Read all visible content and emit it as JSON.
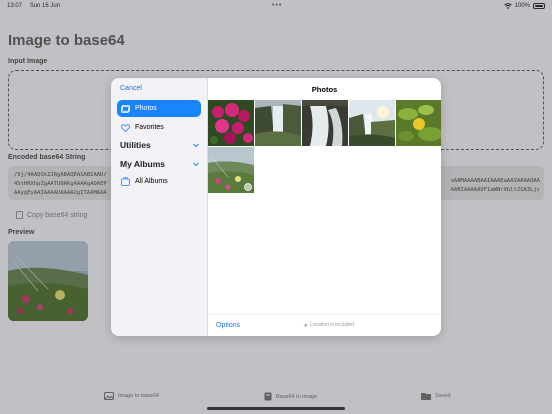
{
  "status_bar": {
    "time": "13:07",
    "date": "Sun 16 Jun",
    "battery": "100%",
    "dots": "•••"
  },
  "app": {
    "title": "Image to base64",
    "input_label": "Input Image",
    "encoded_label": "Encoded base64 String",
    "base64_left_1": "/9j/4AAQSkZJRgABAQEASABIAAD/",
    "base64_left_2": "4StHRXhpZgAATU0AKgAAAAgADAEP",
    "base64_left_3": "AAygEyAAIAAAAUAAAA2gITAAMAAA",
    "base64_right_1": "oAAMAAAABAAIAAAEaAAIAAAAQAA",
    "base64_right_2": "AABIAAAAAVF1aWNrVGltZSA3Ljc",
    "copy_label": "Copy base64 string",
    "preview_label": "Preview"
  },
  "tabs": [
    {
      "label": "Image to base64",
      "icon": "photo-icon"
    },
    {
      "label": "Base64 to image",
      "icon": "document-icon"
    },
    {
      "label": "Saved",
      "icon": "folder-icon"
    }
  ],
  "picker": {
    "cancel": "Cancel",
    "title": "Photos",
    "sidebar": {
      "photos": "Photos",
      "favorites": "Favorites",
      "utilities": "Utilities",
      "my_albums": "My Albums",
      "all_albums": "All Albums"
    },
    "options": "Options",
    "location_note": "Location is included"
  },
  "colors": {
    "accent": "#1a84ff",
    "link": "#1a73e8",
    "background": "#f2f2f7"
  }
}
